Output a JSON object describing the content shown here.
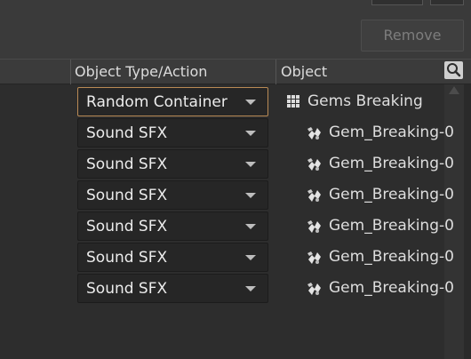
{
  "toolbar": {
    "remove_label": "Remove"
  },
  "columns": {
    "type_action": "Object Type/Action",
    "object": "Object"
  },
  "rows": [
    {
      "type": "Random Container",
      "object": "Gems Breaking",
      "object_icon": "grid-icon",
      "active": true
    },
    {
      "type": "Sound SFX",
      "object": "Gem_Breaking-0",
      "object_icon": "sound-sfx-icon",
      "active": false
    },
    {
      "type": "Sound SFX",
      "object": "Gem_Breaking-0",
      "object_icon": "sound-sfx-icon",
      "active": false
    },
    {
      "type": "Sound SFX",
      "object": "Gem_Breaking-0",
      "object_icon": "sound-sfx-icon",
      "active": false
    },
    {
      "type": "Sound SFX",
      "object": "Gem_Breaking-0",
      "object_icon": "sound-sfx-icon",
      "active": false
    },
    {
      "type": "Sound SFX",
      "object": "Gem_Breaking-0",
      "object_icon": "sound-sfx-icon",
      "active": false
    },
    {
      "type": "Sound SFX",
      "object": "Gem_Breaking-0",
      "object_icon": "sound-sfx-icon",
      "active": false
    }
  ],
  "colors": {
    "active_border": "#b98a55",
    "panel_bg": "#2d2d2d",
    "header_bg": "#3b3b3b"
  }
}
